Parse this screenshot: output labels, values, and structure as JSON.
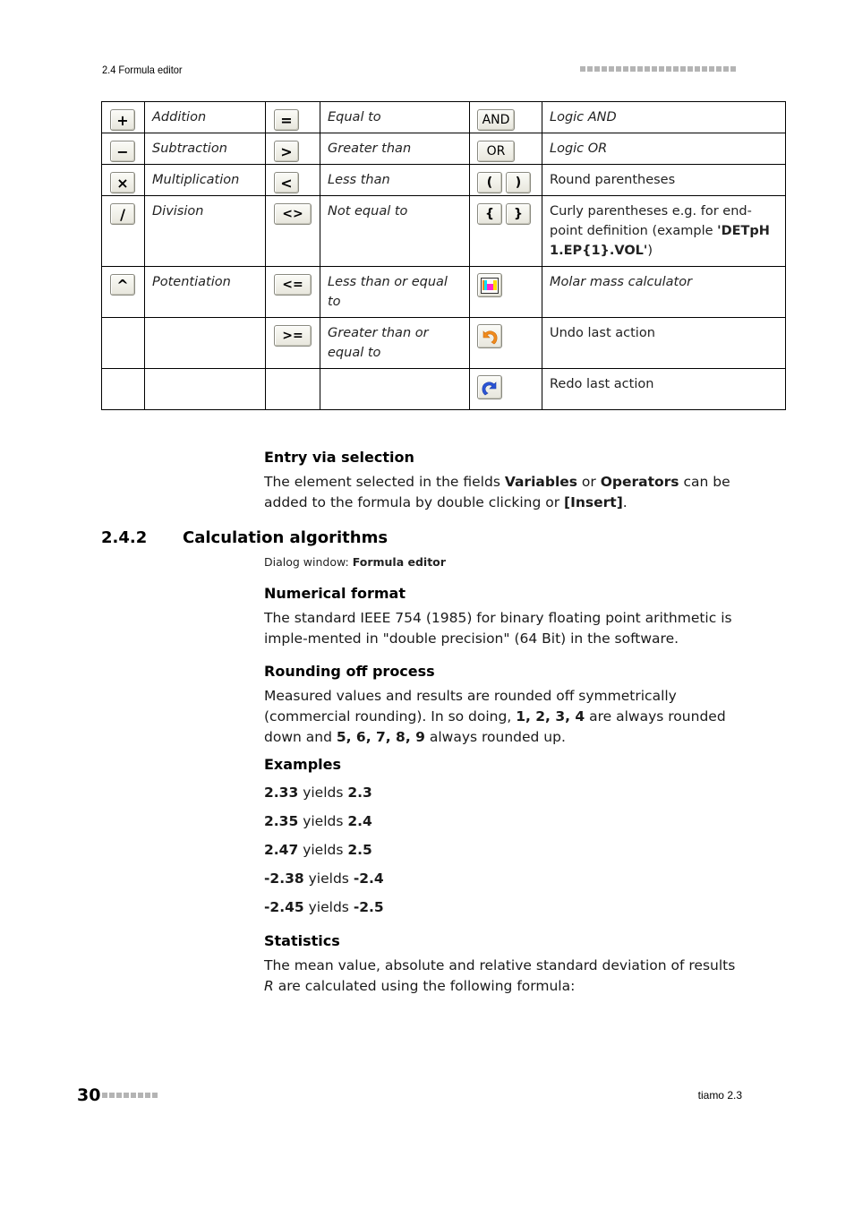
{
  "header": {
    "section": "2.4 Formula editor",
    "decoration": "gray-square-bar"
  },
  "operators_table": {
    "rows": [
      [
        {
          "button": "+",
          "icon": "plus-button-icon",
          "label": "Addition",
          "style": "italic"
        },
        {
          "button": "=",
          "icon": "equals-button-icon",
          "label": "Equal to",
          "style": "italic"
        },
        {
          "button": "AND",
          "icon": "and-button-icon",
          "label": "Logic AND",
          "style": "italic"
        }
      ],
      [
        {
          "button": "−",
          "icon": "minus-button-icon",
          "label": "Subtraction",
          "style": "italic"
        },
        {
          "button": ">",
          "icon": "greater-than-button-icon",
          "label": "Greater than",
          "style": "italic"
        },
        {
          "button": "OR",
          "icon": "or-button-icon",
          "label": "Logic OR",
          "style": "italic"
        }
      ],
      [
        {
          "button": "×",
          "icon": "multiply-button-icon",
          "label": "Multiplication",
          "style": "italic"
        },
        {
          "button": "<",
          "icon": "less-than-button-icon",
          "label": "Less than",
          "style": "italic"
        },
        {
          "buttons": [
            "(",
            ")"
          ],
          "icon": "round-parentheses-button-icon",
          "label": "Round parentheses",
          "style": "roman"
        }
      ],
      [
        {
          "button": "/",
          "icon": "divide-button-icon",
          "label": "Division",
          "style": "italic"
        },
        {
          "button": "<>",
          "icon": "not-equal-button-icon",
          "label": "Not equal to",
          "style": "italic"
        },
        {
          "buttons": [
            "{",
            "}"
          ],
          "icon": "curly-parentheses-button-icon",
          "label": "Curly parentheses e.g. for end-point definition (example ",
          "label_bold": "'DETpH 1.EP{1}.VOL'",
          "label_end": ")",
          "style": "roman"
        }
      ],
      [
        {
          "button": "^",
          "icon": "power-button-icon",
          "label": "Potentiation",
          "style": "italic"
        },
        {
          "button": "<=",
          "icon": "less-equal-button-icon",
          "label": "Less than or equal to",
          "style": "italic"
        },
        {
          "icon": "molar-mass-calculator-icon",
          "label": "Molar mass calculator",
          "style": "italic"
        }
      ],
      [
        {},
        {
          "button": ">=",
          "icon": "greater-equal-button-icon",
          "label": "Greater than or equal to",
          "style": "italic"
        },
        {
          "icon": "undo-icon",
          "label": "Undo last action",
          "style": "roman"
        }
      ],
      [
        {},
        {},
        {
          "icon": "redo-icon",
          "label": "Redo last action",
          "style": "roman"
        }
      ]
    ]
  },
  "entry_via_selection": {
    "heading": "Entry via selection",
    "text_1": "The element selected in the fields ",
    "bold_1": "Variables",
    "text_2": " or ",
    "bold_2": "Operators",
    "text_3": " can be added to the formula by double clicking or ",
    "bold_3": "[Insert]",
    "text_4": "."
  },
  "section": {
    "number": "2.4.2",
    "title": "Calculation algorithms",
    "dialog_label": "Dialog window: ",
    "dialog_name": "Formula editor"
  },
  "numerical_format": {
    "heading": "Numerical format",
    "text": "The standard IEEE 754 (1985) for binary floating point arithmetic is imple-mented in \"double precision\" (64 Bit) in the software."
  },
  "rounding": {
    "heading": "Rounding off process",
    "text_1": "Measured values and results are rounded off symmetrically (commercial rounding). In so doing, ",
    "bold_1": "1, 2, 3, 4",
    "text_2": " are always rounded down and ",
    "bold_2": "5, 6, 7, 8, 9",
    "text_3": " always rounded up."
  },
  "examples": {
    "heading": "Examples",
    "connector": "yields",
    "items": [
      {
        "input": "2.33",
        "output": "2.3"
      },
      {
        "input": "2.35",
        "output": "2.4"
      },
      {
        "input": "2.47",
        "output": "2.5"
      },
      {
        "input": "-2.38",
        "output": "-2.4"
      },
      {
        "input": "-2.45",
        "output": "-2.5"
      }
    ]
  },
  "statistics": {
    "heading": "Statistics",
    "text_1": "The mean value, absolute and relative standard deviation of results ",
    "italic_1": "R",
    "text_2": " are calculated using the following formula:"
  },
  "footer": {
    "page_number": "30",
    "product": "tiamo 2.3"
  }
}
